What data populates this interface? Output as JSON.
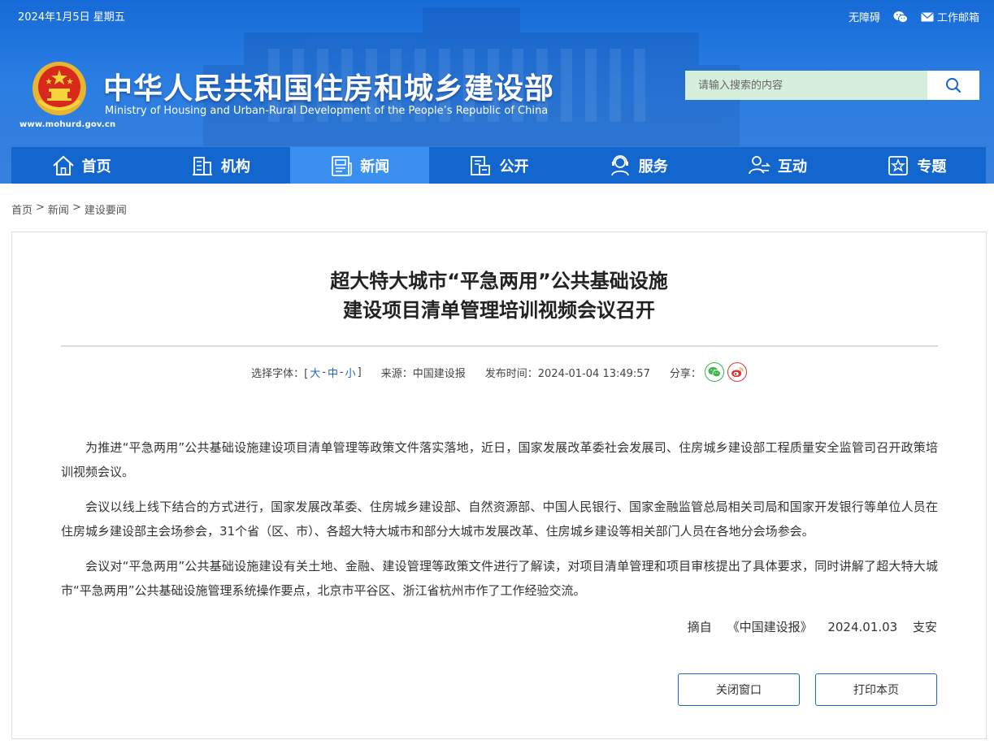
{
  "topbar": {
    "date": "2024年1月5日 星期五",
    "accessibility": "无障碍",
    "mail": "工作邮箱"
  },
  "header": {
    "title": "中华人民共和国住房和城乡建设部",
    "subtitle": "Ministry of Housing and Urban-Rural Development of the People’s Republic of China",
    "url": "www.mohurd.gov.cn"
  },
  "search": {
    "placeholder": "请输入搜索的内容"
  },
  "nav": {
    "items": [
      {
        "label": "首页"
      },
      {
        "label": "机构"
      },
      {
        "label": "新闻"
      },
      {
        "label": "公开"
      },
      {
        "label": "服务"
      },
      {
        "label": "互动"
      },
      {
        "label": "专题"
      }
    ],
    "active_index": 2
  },
  "breadcrumb": {
    "items": [
      "首页",
      "新闻",
      "建设要闻"
    ],
    "separator": ">"
  },
  "article": {
    "title_line1": "超大特大城市“平急两用”公共基础设施",
    "title_line2": "建设项目清单管理培训视频会议召开",
    "meta": {
      "font_label": "选择字体：[",
      "font_large": "大",
      "font_medium": "中",
      "font_small": "小",
      "font_sep": "-",
      "font_end": "]",
      "source": "来源：中国建设报",
      "publish_time": "发布时间：2024-01-04 13:49:57",
      "share": "分享："
    },
    "paragraphs": [
      "为推进“平急两用”公共基础设施建设项目清单管理等政策文件落实落地，近日，国家发展改革委社会发展司、住房城乡建设部工程质量安全监管司召开政策培训视频会议。",
      "会议以线上线下结合的方式进行，国家发展改革委、住房城乡建设部、自然资源部、中国人民银行、国家金融监管总局相关司局和国家开发银行等单位人员在住房城乡建设部主会场参会，31个省（区、市）、各超大特大城市和部分大城市发展改革、住房城乡建设等相关部门人员在各地分会场参会。",
      "会议对“平急两用”公共基础设施建设有关土地、金融、建设管理等政策文件进行了解读，对项目清单管理和项目审核提出了具体要求，同时讲解了超大特大城市“平急两用”公共基础设施管理系统操作要点，北京市平谷区、浙江省杭州市作了工作经验交流。"
    ],
    "signature": "摘自 《中国建设报》 2024.01.03 支安"
  },
  "buttons": {
    "close": "关闭窗口",
    "print": "打印本页"
  },
  "colors": {
    "header_blue": "#1a74e0",
    "nav_blue": "#1466cf",
    "nav_active": "#3a8ff0",
    "link_blue": "#1a66c9",
    "search_bg": "#d6eedc"
  }
}
